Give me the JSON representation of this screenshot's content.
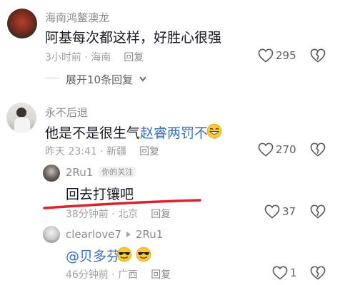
{
  "comments": [
    {
      "username": "海南鸿鳌澳龙",
      "text": "阿基每次都这样，好胜心很强",
      "time": "3小时前",
      "location": "海南",
      "reply_label": "回复",
      "likes": "295"
    },
    {
      "username": "永不后退",
      "text_prefix": "他是不是很生气",
      "text_link": "赵睿两罚不中",
      "emoji": "grin-emoji",
      "time": "昨天 23:41",
      "location": "新疆",
      "reply_label": "回复",
      "likes": "270"
    }
  ],
  "expand_replies": "展开10条回复",
  "replies": [
    {
      "username": "2Ru1",
      "tag": "你的关注",
      "text": "回去打镶吧",
      "time": "38分钟前",
      "location": "北京",
      "reply_label": "回复",
      "likes": "37"
    },
    {
      "username": "clearlove7",
      "reply_to": "2Ru1",
      "mention": "@贝多芬",
      "emoji": "sunglasses-emoji",
      "time": "46分钟前",
      "location": "广西",
      "reply_label": "回复",
      "likes": "1"
    }
  ],
  "colors": {
    "text": "#161823",
    "meta": "#9fa0a6",
    "link": "#3a6fb3",
    "underline": "#d8232a"
  },
  "icons": [
    "heart-icon",
    "dislike-heart-icon",
    "chevron-down-icon",
    "reply-arrow-icon"
  ]
}
